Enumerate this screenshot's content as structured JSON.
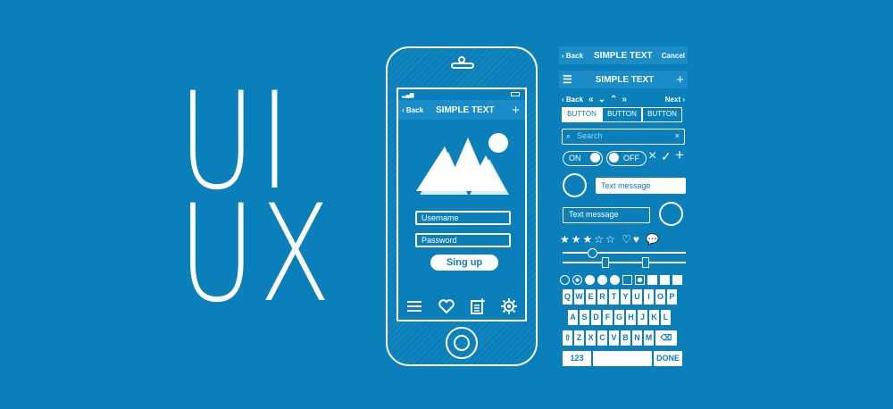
{
  "headline": {
    "line1": "UI",
    "line2": "UX"
  },
  "phone": {
    "nav": {
      "back": "Back",
      "title": "SIMPLE TEXT",
      "plus": "+"
    },
    "form": {
      "username": "Username",
      "password": "Password",
      "signup": "Sing up"
    }
  },
  "kit": {
    "nav1": {
      "back": "Back",
      "title": "SIMPLE TEXT",
      "cancel": "Cancel"
    },
    "nav2": {
      "title": "SIMPLE TEXT",
      "plus": "+"
    },
    "nav3": {
      "back": "Back",
      "next": "Next"
    },
    "segments": [
      "BUTTON",
      "BUTTON",
      "BUTTON"
    ],
    "search": {
      "placeholder": "Search",
      "clear": "×"
    },
    "toggle_on": "ON",
    "toggle_off": "OFF",
    "glyphs": {
      "x": "×",
      "check": "✓",
      "plus": "+"
    },
    "message_in": "Text message",
    "message_out": "Text message",
    "keyboard": {
      "row1": [
        "Q",
        "W",
        "E",
        "R",
        "T",
        "Y",
        "U",
        "I",
        "O",
        "P"
      ],
      "row2": [
        "A",
        "S",
        "D",
        "F",
        "G",
        "H",
        "J",
        "K",
        "L"
      ],
      "row3": [
        "Z",
        "X",
        "C",
        "V",
        "B",
        "N",
        "M"
      ],
      "numbers": "123",
      "done": "DONE"
    }
  },
  "colors": {
    "background": "#0a7fba",
    "foreground": "#ffffff",
    "bar": "#1a8cc7"
  }
}
